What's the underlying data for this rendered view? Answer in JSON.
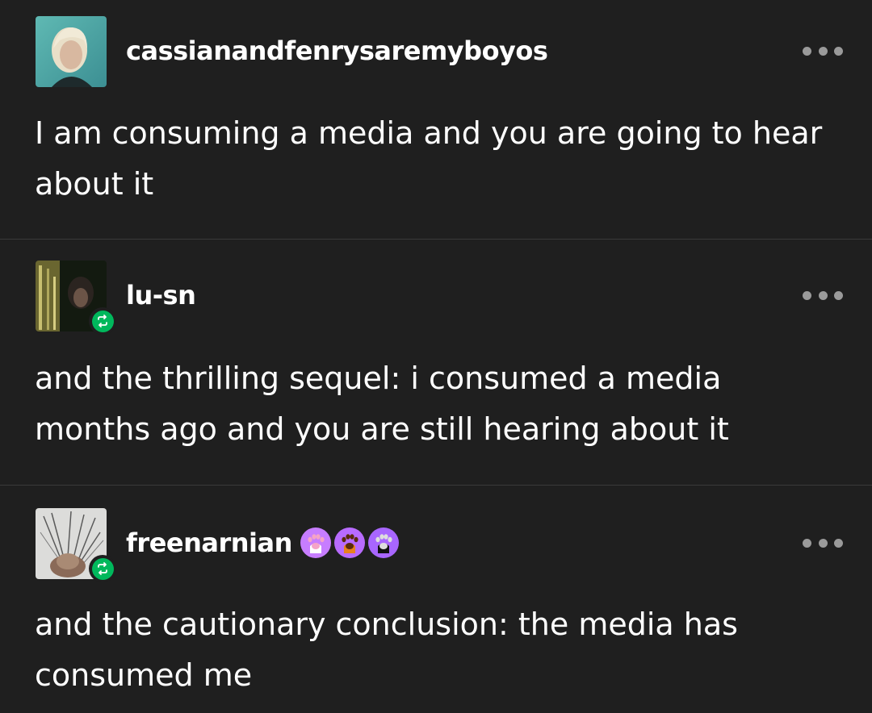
{
  "posts": [
    {
      "username": "cassianandfenrysaremyboyos",
      "text": "I am consuming a media and you are going to hear about it",
      "reblogged": false,
      "badges": []
    },
    {
      "username": "lu-sn",
      "text": "and the thrilling sequel: i consumed a media months ago and you are still hearing about it",
      "reblogged": true,
      "badges": []
    },
    {
      "username": "freenarnian",
      "text": "and the cautionary conclusion: the media has consumed me",
      "reblogged": true,
      "badges": [
        {
          "icon": "paw-icon",
          "color": "#c77dff",
          "paw": "#ffffff"
        },
        {
          "icon": "paw-icon",
          "color": "#b86bff",
          "paw": "#e8821e"
        },
        {
          "icon": "paw-icon",
          "color": "#a866ff",
          "paw": "#111111"
        }
      ]
    }
  ],
  "theme": {
    "background": "#1f1f1f",
    "text": "#ffffff",
    "divider": "#3a3a3a",
    "reblog_green": "#00b85c",
    "more_dots": "#9a9a9a"
  }
}
